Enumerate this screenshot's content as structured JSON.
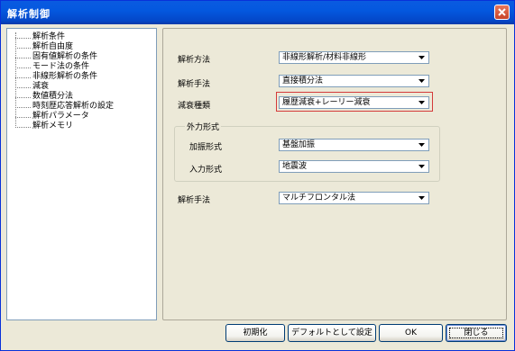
{
  "window": {
    "title": "解析制御",
    "close_icon": "close-icon"
  },
  "tree": {
    "items": [
      "解析条件",
      "解析自由度",
      "固有値解析の条件",
      "モード法の条件",
      "非線形解析の条件",
      "減衰",
      "数値積分法",
      "時刻歴応答解析の設定",
      "解析パラメータ",
      "解析メモリ"
    ]
  },
  "form": {
    "analysis_method": {
      "label": "解析方法",
      "value": "非線形解析/材料非線形"
    },
    "solution_method": {
      "label": "解析手法",
      "value": "直接積分法"
    },
    "damping_type": {
      "label": "減衰種類",
      "value": "履歴減衰+レーリー減衰"
    },
    "external_force": {
      "group_label": "外力形式",
      "excitation_type": {
        "label": "加振形式",
        "value": "基盤加振"
      },
      "input_type": {
        "label": "入力形式",
        "value": "地震波"
      }
    },
    "analysis_technique": {
      "label": "解析手法",
      "value": "マルチフロンタル法"
    }
  },
  "buttons": {
    "init": "初期化",
    "set_default": "デフォルトとして設定",
    "ok": "OK",
    "close": "閉じる"
  },
  "colors": {
    "title_bar": "#0458df",
    "highlight": "#d43a3a",
    "dialog_bg": "#ece9d8"
  }
}
